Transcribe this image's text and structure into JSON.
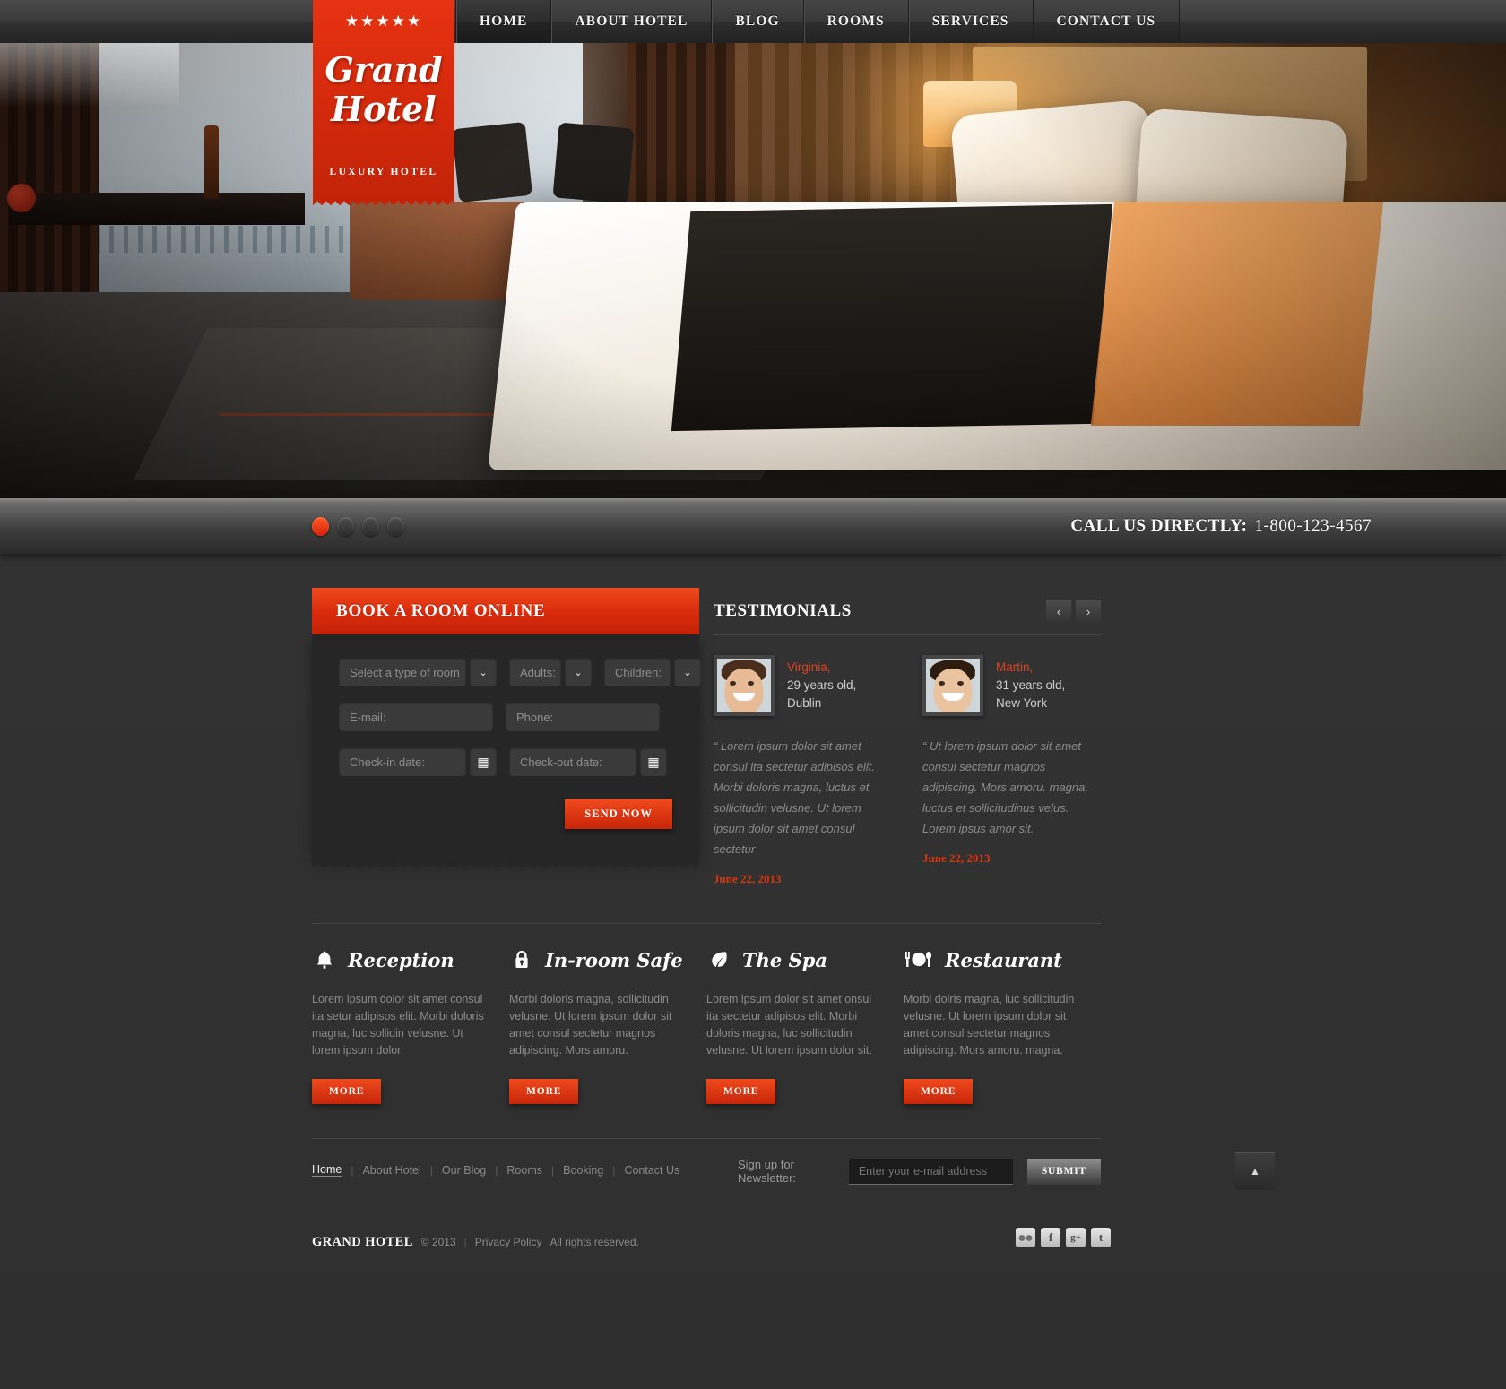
{
  "nav": {
    "items": [
      {
        "label": "HOME",
        "active": true
      },
      {
        "label": "ABOUT HOTEL",
        "active": false
      },
      {
        "label": "BLOG",
        "active": false
      },
      {
        "label": "ROOMS",
        "active": false
      },
      {
        "label": "SERVICES",
        "active": false
      },
      {
        "label": "CONTACT US",
        "active": false
      }
    ]
  },
  "logo": {
    "stars": "★★★★★",
    "line1": "Grand",
    "line2": "Hotel",
    "tagline": "LUXURY HOTEL"
  },
  "slider": {
    "dots": 4,
    "active_index": 0
  },
  "callbar": {
    "label": "CALL US DIRECTLY:",
    "phone": "1-800-123-4567"
  },
  "booking": {
    "title": "BOOK A ROOM ONLINE",
    "room_placeholder": "Select a type of room",
    "adults_placeholder": "Adults:",
    "children_placeholder": "Children:",
    "email_placeholder": "E-mail:",
    "phone_placeholder": "Phone:",
    "checkin_placeholder": "Check-in date:",
    "checkout_placeholder": "Check-out date:",
    "submit_label": "SEND NOW",
    "chevron": "⌄",
    "calendar_icon": "▦"
  },
  "testimonials": {
    "title": "TESTIMONIALS",
    "prev": "‹",
    "next": "›",
    "items": [
      {
        "name": "Virginia,",
        "age": "29 years old,",
        "city": "Dublin",
        "quote": "“ Lorem ipsum dolor sit amet consul ita sectetur adipisos elit. Morbi doloris magna, luctus et sollicitudin velusne. Ut lorem ipsum dolor sit amet consul sectetur",
        "date": "June 22, 2013"
      },
      {
        "name": "Martin,",
        "age": "31 years old,",
        "city": "New York",
        "quote": "“ Ut lorem ipsum dolor sit amet consul sectetur magnos adipiscing. Mors amoru. magna, luctus et sollicitudinus velus. Lorem ipsus amor sit.",
        "date": "June 22, 2013"
      }
    ]
  },
  "services": {
    "more_label": "MORE",
    "items": [
      {
        "icon": "bell-icon",
        "title": "Reception",
        "text": "Lorem ipsum dolor sit amet consul ita setur adipisos elit. Morbi doloris magna, luc sollidin velusne. Ut lorem ipsum dolor."
      },
      {
        "icon": "lock-icon",
        "title": "In-room Safe",
        "text": "Morbi doloris magna, sollicitudin velusne. Ut lorem ipsum dolor sit amet consul sectetur magnos adipiscing. Mors amoru."
      },
      {
        "icon": "leaf-icon",
        "title": "The Spa",
        "text": "Lorem ipsum dolor sit amet onsul ita sectetur adipisos elit. Morbi doloris magna, luc sollicitudin velusne. Ut lorem ipsum dolor sit."
      },
      {
        "icon": "restaurant-icon",
        "title": "Restaurant",
        "text": "Morbi dolris magna, luc sollicitudin velusne. Ut lorem ipsum dolor sit amet consul sectetur magnos adipiscing. Mors amoru. magna."
      }
    ]
  },
  "footer": {
    "nav": [
      {
        "label": "Home",
        "active": true
      },
      {
        "label": "About Hotel",
        "active": false
      },
      {
        "label": "Our Blog",
        "active": false
      },
      {
        "label": "Rooms",
        "active": false
      },
      {
        "label": "Booking",
        "active": false
      },
      {
        "label": "Contact Us",
        "active": false
      }
    ],
    "separator": "|",
    "newsletter_label": "Sign up for Newsletter:",
    "newsletter_placeholder": "Enter your e-mail address",
    "newsletter_button": "SUBMIT",
    "to_top_icon": "▲",
    "brand": "GRAND HOTEL",
    "copyright": "© 2013",
    "privacy": "Privacy Policy",
    "rights": "All rights reserved.",
    "social": [
      {
        "name": "flickr-icon",
        "glyph": "••"
      },
      {
        "name": "facebook-icon",
        "glyph": "f"
      },
      {
        "name": "googleplus-icon",
        "glyph": "g+"
      },
      {
        "name": "twitter-icon",
        "glyph": "t"
      }
    ]
  },
  "colors": {
    "accent": "#d8290b",
    "accent_light": "#ef4a1d",
    "bg": "#2e2e2e",
    "panel": "#262626"
  }
}
